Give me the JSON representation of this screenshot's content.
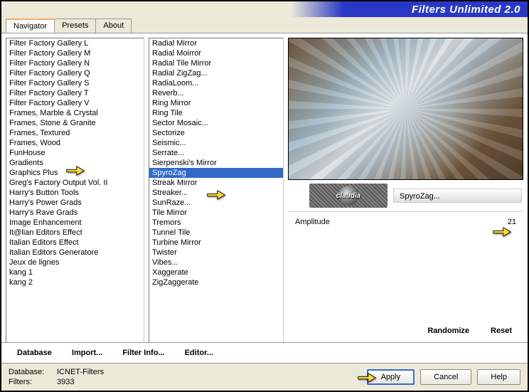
{
  "title": "Filters Unlimited 2.0",
  "tabs": {
    "navigator": "Navigator",
    "presets": "Presets",
    "about": "About"
  },
  "categories": [
    "Filter Factory Gallery L",
    "Filter Factory Gallery M",
    "Filter Factory Gallery N",
    "Filter Factory Gallery Q",
    "Filter Factory Gallery S",
    "Filter Factory Gallery T",
    "Filter Factory Gallery V",
    "Frames, Marble & Crystal",
    "Frames, Stone & Granite",
    "Frames, Textured",
    "Frames, Wood",
    "FunHouse",
    "Gradients",
    "Graphics Plus",
    "Greg's Factory Output Vol. II",
    "Harry's Button Tools",
    "Harry's Power Grads",
    "Harry's Rave Grads",
    "Image Enhancement",
    "It@lian Editors Effect",
    "Italian Editors Effect",
    "Italian Editors Generatore",
    "Jeux de lignes",
    "kang 1",
    "kang 2"
  ],
  "filters": [
    "Radial Mirror",
    "Radial Moirror",
    "Radial Tile Mirror",
    "Radial ZigZag...",
    "RadiaLoom...",
    "Reverb...",
    "Ring Mirror",
    "Ring Tile",
    "Sector Mosaic...",
    "Sectorize",
    "Seismic...",
    "Serrate...",
    "Sierpenski's Mirror",
    "SpyroZag",
    "Streak Mirror",
    "Streaker...",
    "SunRaze...",
    "Tile Mirror",
    "Tremors",
    "Tunnel Tile",
    "Turbine Mirror",
    "Twister",
    "Vibes...",
    "Xaggerate",
    "ZigZaggerate"
  ],
  "selected_filter": "SpyroZag",
  "stamp_text": "claudia",
  "current_filter_display": "SpyroZag...",
  "param": {
    "name": "Amplitude",
    "value": "21"
  },
  "buttons": {
    "database": "Database",
    "import": "Import...",
    "filter_info": "Filter Info...",
    "editor": "Editor...",
    "randomize": "Randomize",
    "reset": "Reset",
    "apply": "Apply",
    "cancel": "Cancel",
    "help": "Help"
  },
  "footer": {
    "db_label": "Database:",
    "db_value": "ICNET-Filters",
    "filters_label": "Filters:",
    "filters_value": "3933"
  }
}
